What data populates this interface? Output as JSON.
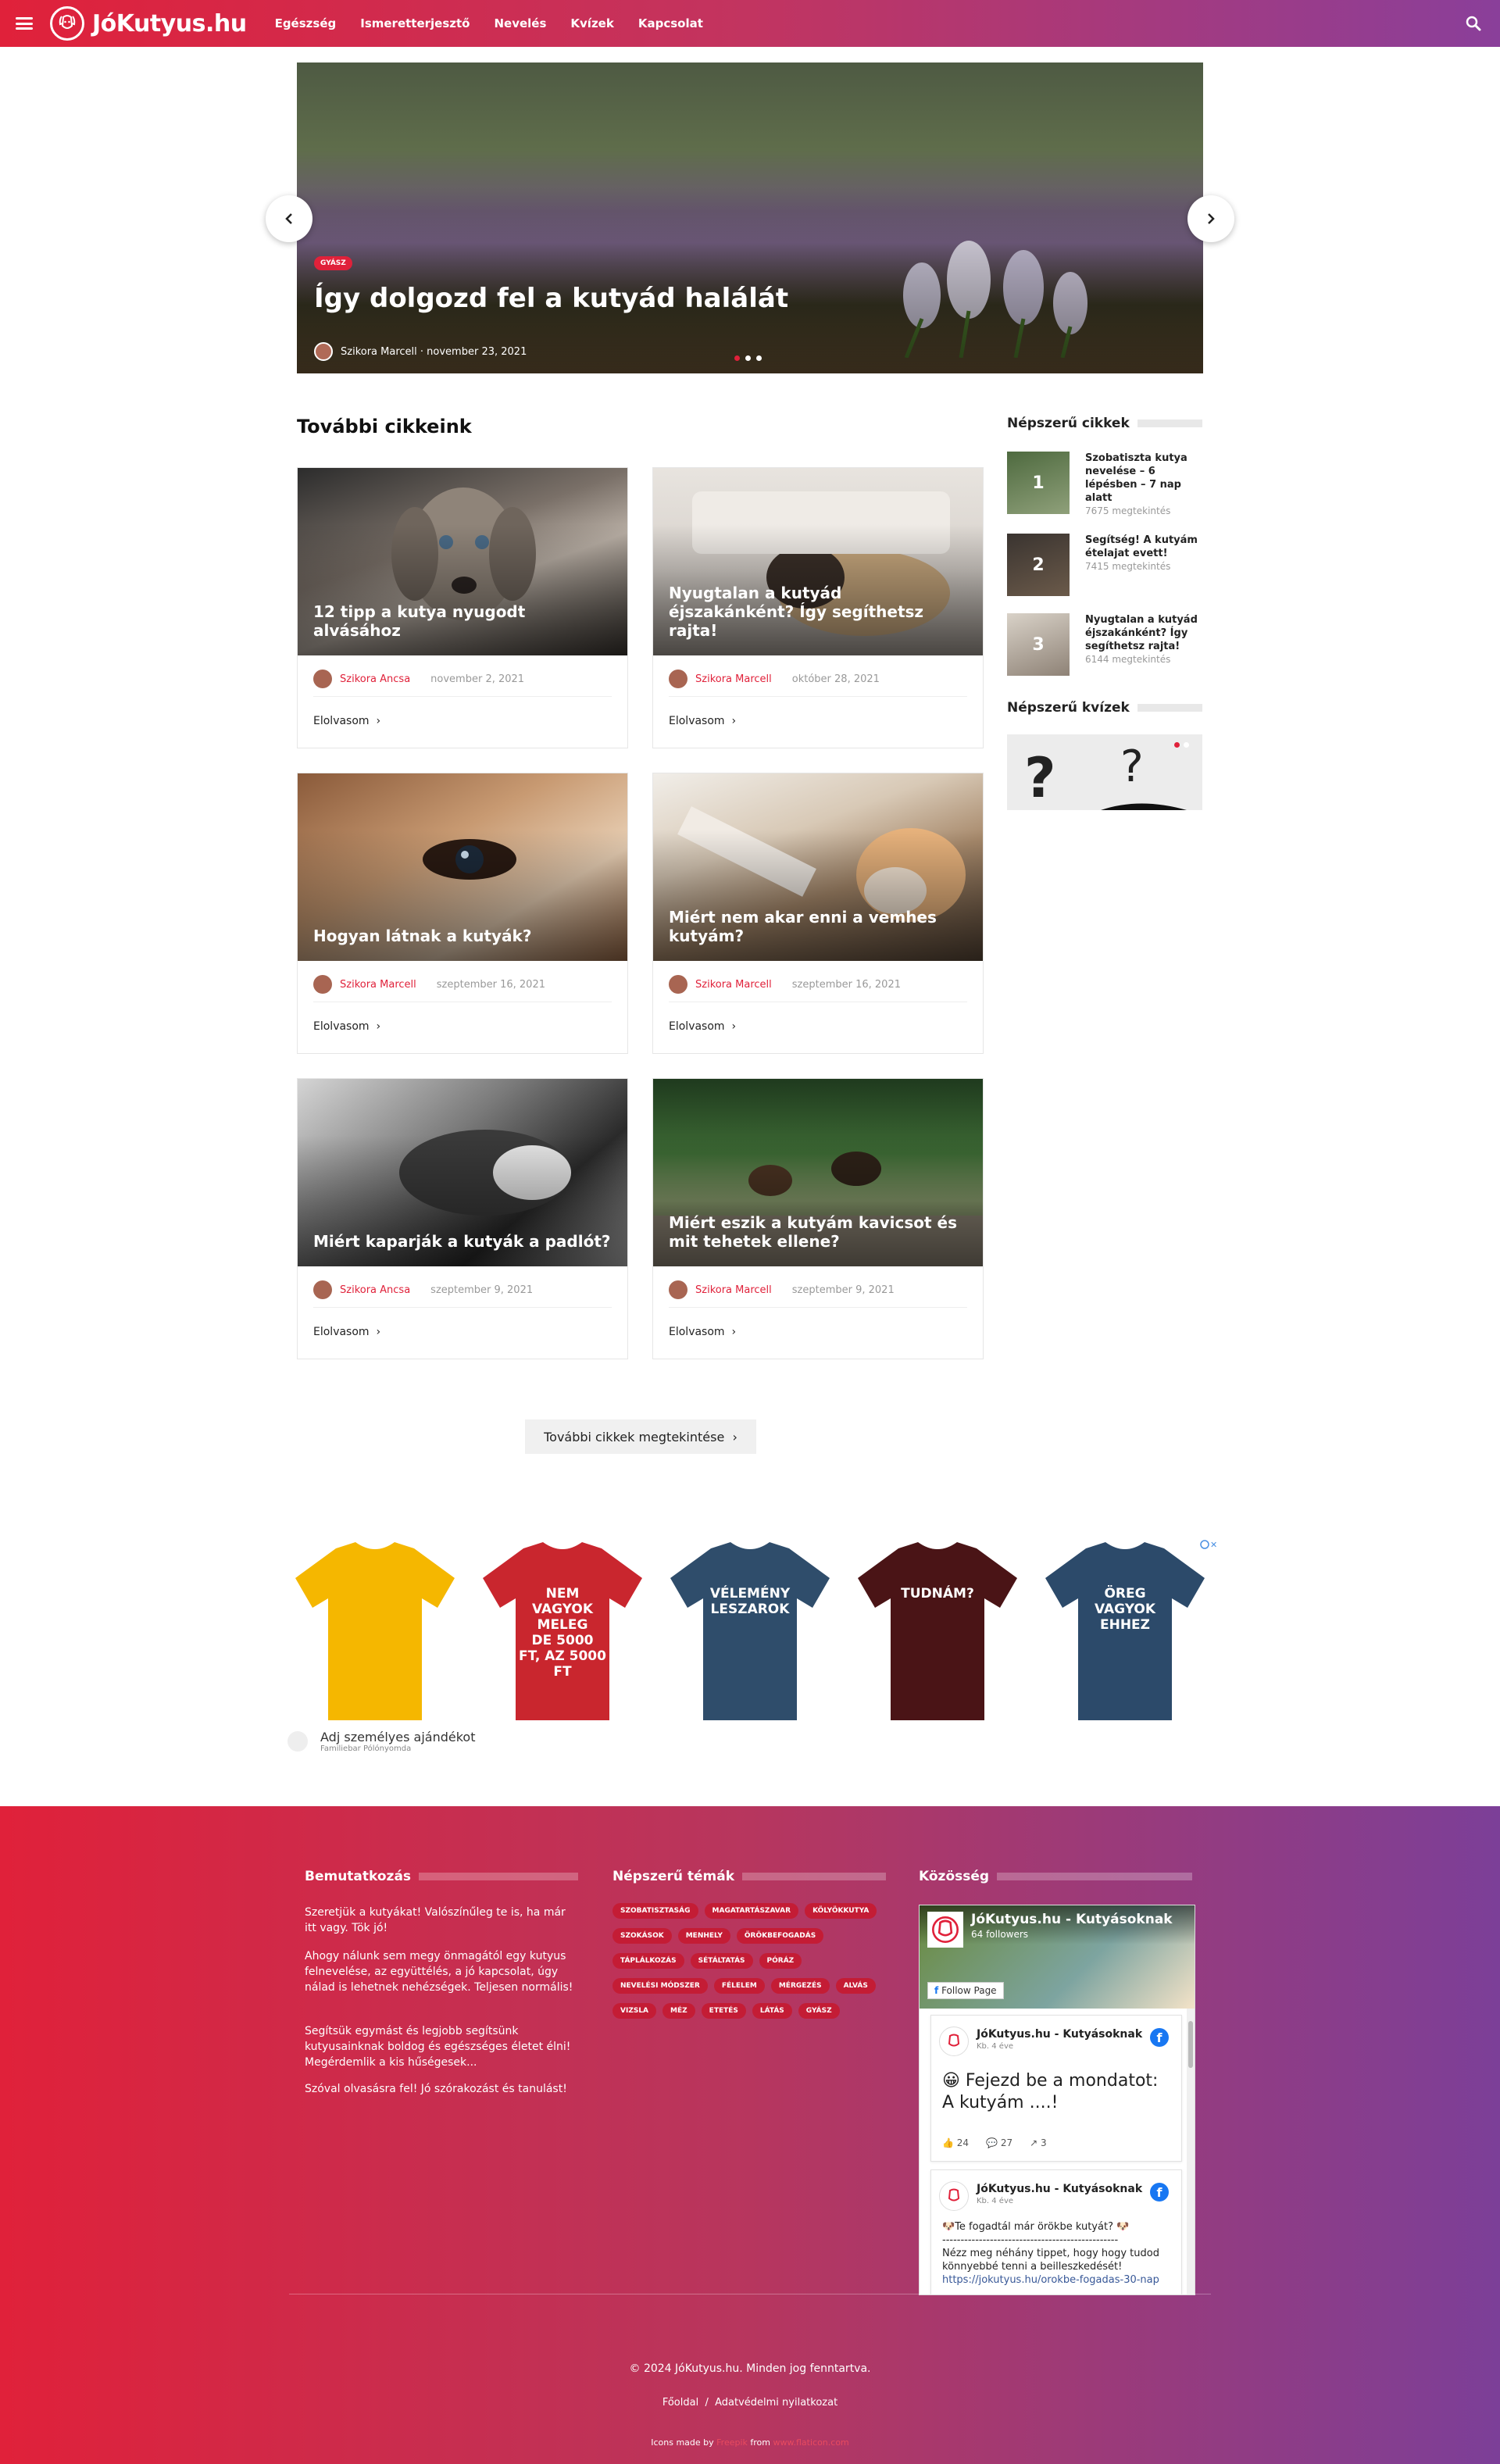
{
  "header": {
    "logo_text": "JóKutyus.hu",
    "nav": [
      "Egészség",
      "Ismeretterjesztő",
      "Nevelés",
      "Kvízek",
      "Kapcsolat"
    ]
  },
  "slider": {
    "badge": "GYÁSZ",
    "title": "Így dolgozd fel a kutyád halálát",
    "author": "Szikora Marcell",
    "date": "november 23, 2021",
    "active_dot": 1,
    "dot_count": 3
  },
  "articles": {
    "section_title": "További cikkeink",
    "read_more": "Elolvasom",
    "more_button": "További cikkek megtekintése",
    "items": [
      {
        "title": "12 tipp a kutya nyugodt alvásához",
        "author": "Szikora Ancsa",
        "date": "november 2, 2021"
      },
      {
        "title": "Nyugtalan a kutyád éjszakánként? Így segíthetsz rajta!",
        "author": "Szikora Marcell",
        "date": "október 28, 2021"
      },
      {
        "title": "Hogyan látnak a kutyák?",
        "author": "Szikora Marcell",
        "date": "szeptember 16, 2021"
      },
      {
        "title": "Miért nem akar enni a vemhes kutyám?",
        "author": "Szikora Marcell",
        "date": "szeptember 16, 2021"
      },
      {
        "title": "Miért kaparják a kutyák a padlót?",
        "author": "Szikora Ancsa",
        "date": "szeptember 9, 2021"
      },
      {
        "title": "Miért eszik a kutyám kavicsot és mit tehetek ellene?",
        "author": "Szikora Marcell",
        "date": "szeptember 9, 2021"
      }
    ]
  },
  "sidebar": {
    "popular_title": "Népszerű cikkek",
    "popular": [
      {
        "num": "1",
        "title": "Szobatiszta kutya nevelése – 6 lépésben – 7 nap alatt",
        "views": "7675 megtekintés"
      },
      {
        "num": "2",
        "title": "Segítség! A kutyám ételajat evett!",
        "views": "7415 megtekintés"
      },
      {
        "num": "3",
        "title": "Nyugtalan a kutyád éjszakánként? Így segíthetsz rajta!",
        "views": "6144 megtekintés"
      }
    ],
    "quiz_title": "Népszerű kvízek"
  },
  "ad": {
    "shirts": [
      {
        "color": "#f5b700",
        "text": ""
      },
      {
        "color": "#c9262e",
        "text": "NEM VAGYOK MELEG\nDE 5000 FT, AZ 5000 FT"
      },
      {
        "color": "#2f4d6b",
        "text": "VÉLEMÉNY\nLESZAROK"
      },
      {
        "color": "#4a1416",
        "text": "TUDNÁM?"
      },
      {
        "color": "#2c4a6a",
        "text": "ÖREG VAGYOK\nEHHEZ"
      }
    ],
    "advertiser_line": "Adj személyes ajándékot",
    "advertiser_name": "Familiebar Pólónyomda"
  },
  "footer": {
    "about_title": "Bemutatkozás",
    "about_paragraphs": [
      "Szeretjük a kutyákat! Valószínűleg te is, ha már itt vagy. Tök jó!",
      "Ahogy nálunk sem megy önmagától egy kutyus felnevelése, az együttélés, a jó kapcsolat, úgy nálad is lehetnek nehézségek. Teljesen normális!",
      "Segítsük egymást és legjobb segítsünk kutyusainknak boldog és egészséges életet élni! Megérdemlik a kis hűségesek...",
      "Szóval olvasásra fel! Jó szórakozást és tanulást!"
    ],
    "topics_title": "Népszerű témák",
    "tags": [
      "SZOBATISZTASÁG",
      "MAGATARTÁSZAVAR",
      "KÖLYÖKKUTYA",
      "SZOKÁSOK",
      "MENHELY",
      "ÖRÖKBEFOGADÁS",
      "TÁPLÁLKOZÁS",
      "SÉTÁLTATÁS",
      "PÓRÁZ",
      "NEVELÉSI MÓDSZER",
      "FÉLELEM",
      "MÉRGEZÉS",
      "ALVÁS",
      "VIZSLA",
      "MÉZ",
      "ETETÉS",
      "LÁTÁS",
      "GYÁSZ"
    ],
    "community_title": "Közösség",
    "fb": {
      "page_name": "JóKutyus.hu - Kutyásoknak",
      "followers": "64 followers",
      "follow": "Follow Page",
      "post1_time": "Kb. 4 éve",
      "post1_text": "😀 Fejezd be a mondatot: A kutyám ....!",
      "post1_likes": "24",
      "post1_comments": "27",
      "post1_shares": "3",
      "post2_time": "Kb. 4 éve",
      "post2_line1": "🐶Te fogadtál már örökbe kutyát? 🐶",
      "post2_line2": "------------------------------------------------",
      "post2_line3": "Nézz meg néhány tippet, hogy hogy tudod könnyebbé tenni a beilleszkedését!",
      "post2_link": "https://jokutyus.hu/orokbe-fogadas-30-nap"
    },
    "copyright": "© 2024 JóKutyus.hu. Minden jog fenntartva.",
    "links": [
      "Főoldal",
      "Adatvédelmi nyilatkozat"
    ],
    "icons_made_by": "Icons made by",
    "icons_from": "from"
  }
}
